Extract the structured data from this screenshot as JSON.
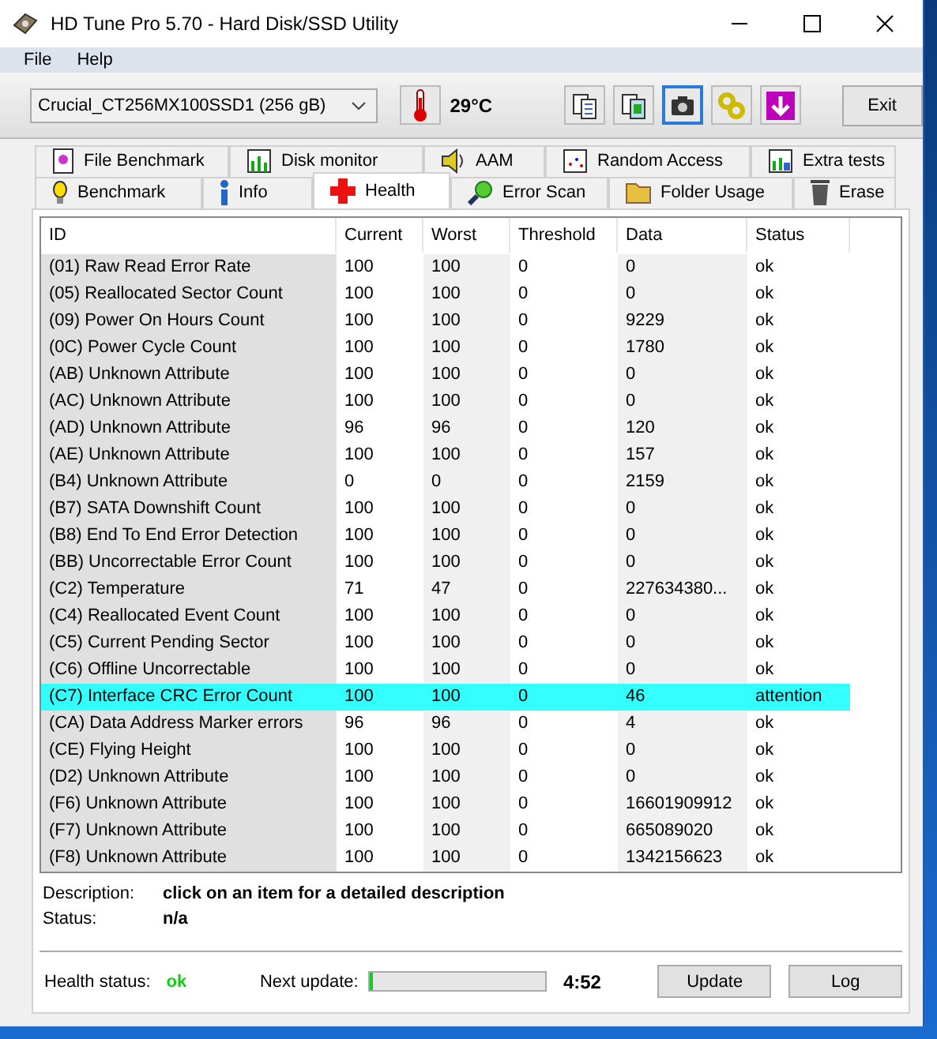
{
  "window": {
    "title": "HD Tune Pro 5.70 - Hard Disk/SSD Utility"
  },
  "menu": [
    {
      "label": "File"
    },
    {
      "label": "Help"
    }
  ],
  "toolbar": {
    "drive": "Crucial_CT256MX100SSD1 (256 gB)",
    "temperature": "29°C",
    "icon_buttons": [
      {
        "selected": false
      },
      {
        "selected": false
      },
      {
        "selected": true
      },
      {
        "selected": false
      },
      {
        "selected": false
      }
    ],
    "exit": "Exit"
  },
  "tabs_top": [
    {
      "label": "File Benchmark",
      "selected": false
    },
    {
      "label": "Disk monitor",
      "selected": false
    },
    {
      "label": "AAM",
      "selected": false
    },
    {
      "label": "Random Access",
      "selected": false
    },
    {
      "label": "Extra tests",
      "selected": false
    }
  ],
  "tabs_bottom": [
    {
      "label": "Benchmark",
      "selected": false
    },
    {
      "label": "Info",
      "selected": false
    },
    {
      "label": "Health",
      "selected": true
    },
    {
      "label": "Error Scan",
      "selected": false
    },
    {
      "label": "Folder Usage",
      "selected": false
    },
    {
      "label": "Erase",
      "selected": false
    }
  ],
  "table": {
    "columns": [
      "ID",
      "Current",
      "Worst",
      "Threshold",
      "Data",
      "Status"
    ],
    "rows": [
      {
        "cells": [
          "(01) Raw Read Error Rate",
          "100",
          "100",
          "0",
          "0",
          "ok"
        ],
        "selected": false
      },
      {
        "cells": [
          "(05) Reallocated Sector Count",
          "100",
          "100",
          "0",
          "0",
          "ok"
        ],
        "selected": false
      },
      {
        "cells": [
          "(09) Power On Hours Count",
          "100",
          "100",
          "0",
          "9229",
          "ok"
        ],
        "selected": false
      },
      {
        "cells": [
          "(0C) Power Cycle Count",
          "100",
          "100",
          "0",
          "1780",
          "ok"
        ],
        "selected": false
      },
      {
        "cells": [
          "(AB) Unknown Attribute",
          "100",
          "100",
          "0",
          "0",
          "ok"
        ],
        "selected": false
      },
      {
        "cells": [
          "(AC) Unknown Attribute",
          "100",
          "100",
          "0",
          "0",
          "ok"
        ],
        "selected": false
      },
      {
        "cells": [
          "(AD) Unknown Attribute",
          "96",
          "96",
          "0",
          "120",
          "ok"
        ],
        "selected": false
      },
      {
        "cells": [
          "(AE) Unknown Attribute",
          "100",
          "100",
          "0",
          "157",
          "ok"
        ],
        "selected": false
      },
      {
        "cells": [
          "(B4) Unknown Attribute",
          "0",
          "0",
          "0",
          "2159",
          "ok"
        ],
        "selected": false
      },
      {
        "cells": [
          "(B7) SATA Downshift Count",
          "100",
          "100",
          "0",
          "0",
          "ok"
        ],
        "selected": false
      },
      {
        "cells": [
          "(B8) End To End Error Detection",
          "100",
          "100",
          "0",
          "0",
          "ok"
        ],
        "selected": false
      },
      {
        "cells": [
          "(BB) Uncorrectable Error Count",
          "100",
          "100",
          "0",
          "0",
          "ok"
        ],
        "selected": false
      },
      {
        "cells": [
          "(C2) Temperature",
          "71",
          "47",
          "0",
          "227634380...",
          "ok"
        ],
        "selected": false
      },
      {
        "cells": [
          "(C4) Reallocated Event Count",
          "100",
          "100",
          "0",
          "0",
          "ok"
        ],
        "selected": false
      },
      {
        "cells": [
          "(C5) Current Pending Sector",
          "100",
          "100",
          "0",
          "0",
          "ok"
        ],
        "selected": false
      },
      {
        "cells": [
          "(C6) Offline Uncorrectable",
          "100",
          "100",
          "0",
          "0",
          "ok"
        ],
        "selected": false
      },
      {
        "cells": [
          "(C7) Interface CRC Error Count",
          "100",
          "100",
          "0",
          "46",
          "attention"
        ],
        "selected": true
      },
      {
        "cells": [
          "(CA) Data Address Marker errors",
          "96",
          "96",
          "0",
          "4",
          "ok"
        ],
        "selected": false
      },
      {
        "cells": [
          "(CE) Flying Height",
          "100",
          "100",
          "0",
          "0",
          "ok"
        ],
        "selected": false
      },
      {
        "cells": [
          "(D2) Unknown Attribute",
          "100",
          "100",
          "0",
          "0",
          "ok"
        ],
        "selected": false
      },
      {
        "cells": [
          "(F6) Unknown Attribute",
          "100",
          "100",
          "0",
          "16601909912",
          "ok"
        ],
        "selected": false
      },
      {
        "cells": [
          "(F7) Unknown Attribute",
          "100",
          "100",
          "0",
          "665089020",
          "ok"
        ],
        "selected": false
      },
      {
        "cells": [
          "(F8) Unknown Attribute",
          "100",
          "100",
          "0",
          "1342156623",
          "ok"
        ],
        "selected": false
      }
    ]
  },
  "details": [
    {
      "label": "Description:",
      "value": "click on an item for a detailed description"
    },
    {
      "label": "Status:",
      "value": "n/a"
    }
  ],
  "footer": {
    "health_label": "Health status:",
    "health_value": "ok",
    "next_label": "Next update:",
    "level": 0.02,
    "time": "4:52",
    "buttons": [
      "Update",
      "Log"
    ]
  }
}
